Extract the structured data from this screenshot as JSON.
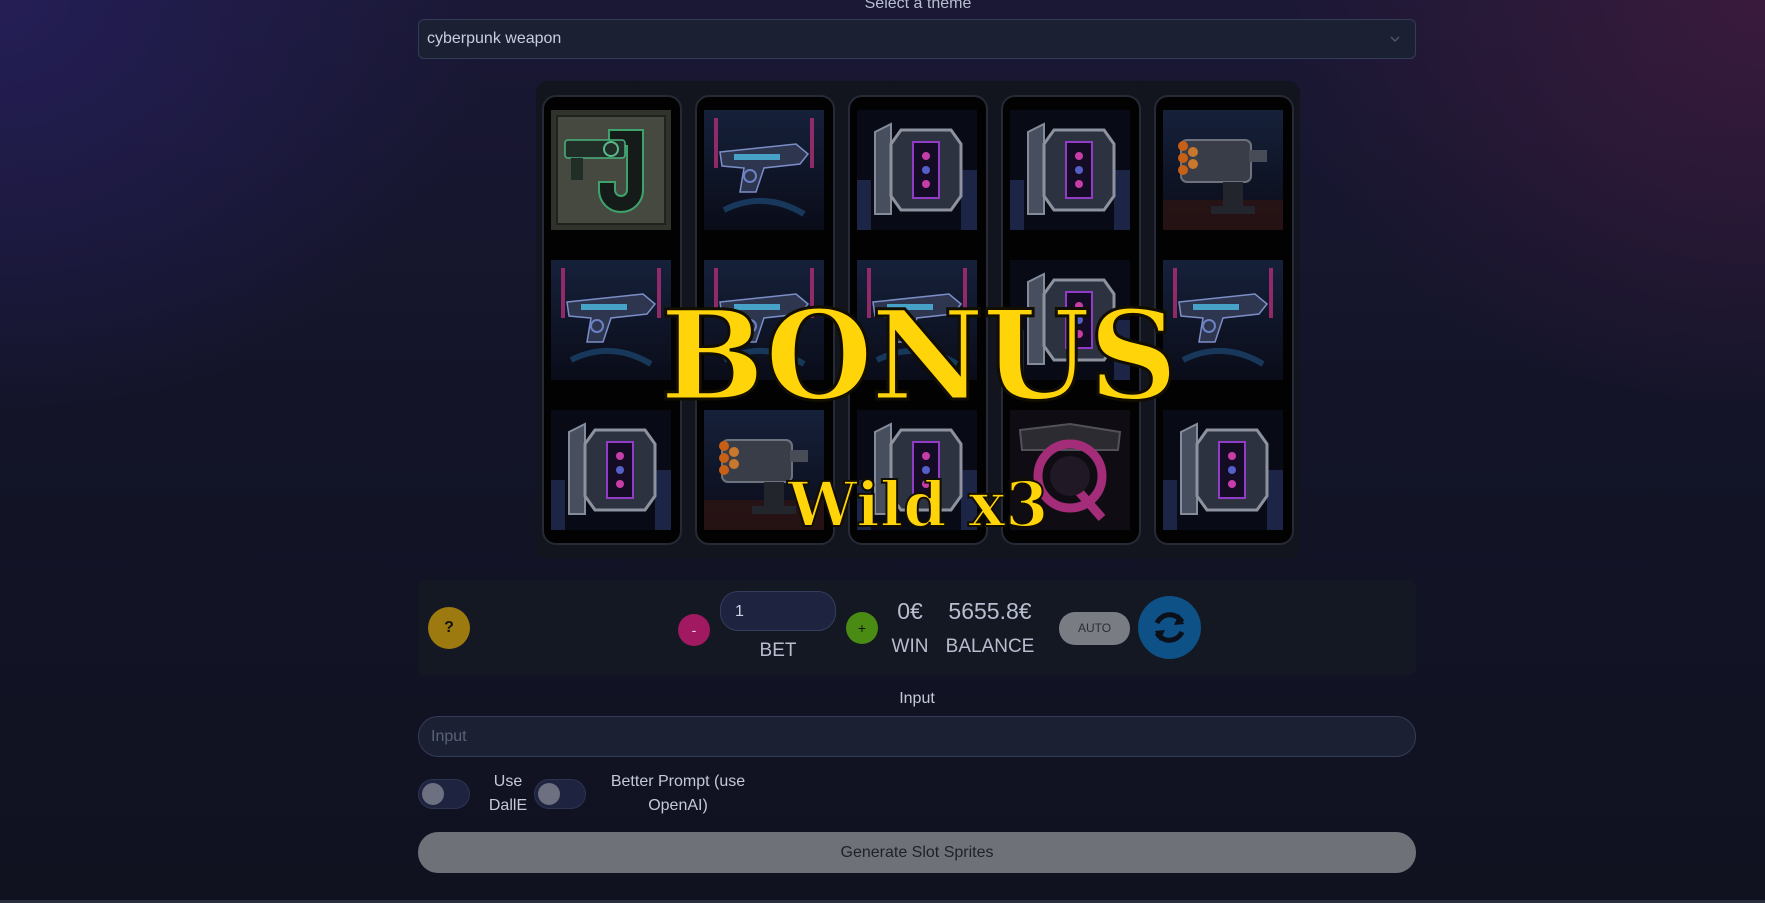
{
  "theme": {
    "label": "Select a theme",
    "selected": "cyberpunk weapon"
  },
  "reels": [
    [
      "J",
      "pistol",
      "10"
    ],
    [
      "pistol",
      "pistol",
      "rocket-launcher"
    ],
    [
      "10",
      "pistol",
      "10"
    ],
    [
      "10",
      "10",
      "Q"
    ],
    [
      "rocket-launcher",
      "pistol",
      "10"
    ]
  ],
  "bonus": {
    "title": "BONUS",
    "subtitle": "Wild x3"
  },
  "controls": {
    "help_label": "?",
    "minus_label": "-",
    "plus_label": "+",
    "bet_value": "1",
    "bet_label": "BET",
    "win_value": "0€",
    "win_label": "WIN",
    "balance_value": "5655.8€",
    "balance_label": "BALANCE",
    "auto_label": "AUTO"
  },
  "prompt": {
    "label": "Input",
    "placeholder": "Input",
    "use_dalle_label_line1": "Use",
    "use_dalle_label_line2": "DallE",
    "better_prompt_line1": "Better Prompt (use",
    "better_prompt_line2": "OpenAI)",
    "generate_label": "Generate Slot Sprites"
  },
  "colors": {
    "bonus_text": "#ffd50a",
    "help_button": "#9c7a10",
    "minus_button": "#a11960",
    "plus_button": "#4a8b14",
    "refresh_button": "#0e5186"
  }
}
